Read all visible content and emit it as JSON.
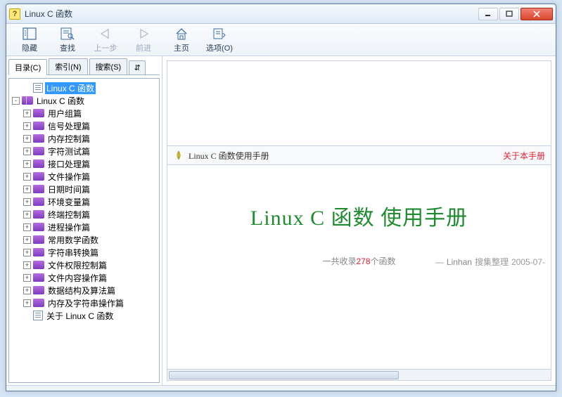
{
  "window": {
    "title": "Linux C 函数",
    "app_icon_letter": "?"
  },
  "toolbar": {
    "hide": "隐藏",
    "find": "查找",
    "back": "上一步",
    "forward": "前进",
    "home": "主页",
    "options": "选项(O)"
  },
  "tabs": {
    "contents": "目录(C)",
    "index": "索引(N)",
    "search": "搜索(S)",
    "overflow": "⇵"
  },
  "tree": {
    "root_selected": "Linux C 函数",
    "root_open": "Linux C 函数",
    "chapters": [
      "用户组篇",
      "信号处理篇",
      "内存控制篇",
      "字符测试篇",
      "接口处理篇",
      "文件操作篇",
      "日期时间篇",
      "环境变量篇",
      "终端控制篇",
      "进程操作篇",
      "常用数学函数",
      "字符串转换篇",
      "文件权限控制篇",
      "文件内容操作篇",
      "数据结构及算法篇",
      "内存及字符串操作篇"
    ],
    "about": "关于 Linux C 函数"
  },
  "document": {
    "header_title": "Linux C 函数使用手册",
    "about_link": "关于本手册",
    "main_title": "Linux C 函数 使用手册",
    "stats_prefix": "一共收录",
    "stats_count": "278",
    "stats_suffix": "个函数",
    "author": "Linhan",
    "author_suffix": "搜集整理",
    "date": "2005-07-"
  }
}
